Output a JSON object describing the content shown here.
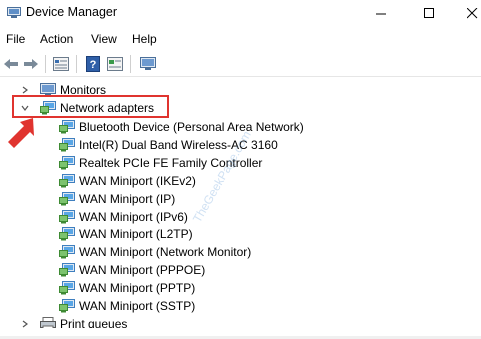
{
  "window": {
    "title": "Device Manager",
    "controls": {
      "minimize": "—",
      "maximize": "☐",
      "close": "✕"
    }
  },
  "menu": [
    "File",
    "Action",
    "View",
    "Help"
  ],
  "toolbar": {
    "buttons": [
      "back-icon",
      "forward-icon",
      "properties-icon",
      "help-icon",
      "update-driver-icon",
      "monitor-icon"
    ]
  },
  "tree": {
    "monitors": "Monitors",
    "network_adapters": "Network adapters",
    "adapters": [
      "Bluetooth Device (Personal Area Network)",
      "Intel(R) Dual Band Wireless-AC 3160",
      "Realtek PCIe FE Family Controller",
      "WAN Miniport (IKEv2)",
      "WAN Miniport (IP)",
      "WAN Miniport (IPv6)",
      "WAN Miniport (L2TP)",
      "WAN Miniport (Network Monitor)",
      "WAN Miniport (PPPOE)",
      "WAN Miniport (PPTP)",
      "WAN Miniport (SSTP)"
    ],
    "print_queues": "Print queues"
  },
  "annotation": {
    "highlight_color": "#e0342f",
    "arrow_color": "#e0342f"
  },
  "watermark": "TheGeekPage.com"
}
